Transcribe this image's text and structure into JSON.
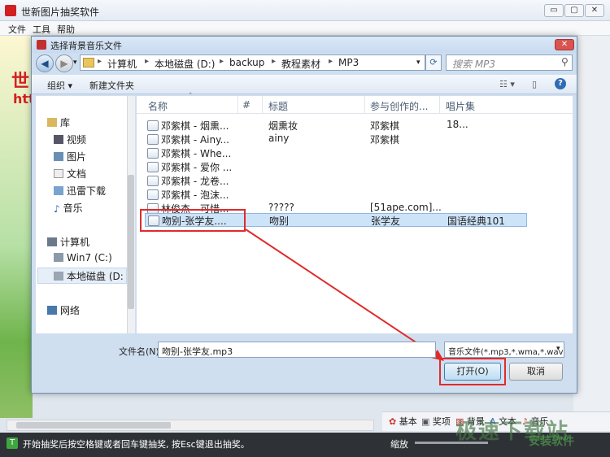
{
  "app": {
    "title": "世新图片抽奖软件",
    "menu": [
      "文件",
      "工具",
      "帮助"
    ],
    "left_text1": "世",
    "left_text2": "htt",
    "status_text": "开始抽奖后按空格键或者回车键抽奖, 按Esc键退出抽奖。",
    "status_icon": "T",
    "zoom_label": "缩放",
    "bottom_tabs": [
      "基本",
      "奖项",
      "背景",
      "文本",
      "音乐"
    ],
    "window_buttons": [
      "▭",
      "▢",
      "✕"
    ],
    "watermark": "极速下载站",
    "watermark_small": "安装软件"
  },
  "dialog": {
    "title": "选择背景音乐文件",
    "close_label": "✕",
    "breadcrumb": [
      "计算机",
      "本地磁盘 (D:)",
      "backup",
      "教程素材",
      "MP3"
    ],
    "search_placeholder": "搜索 MP3",
    "toolbar": {
      "organize": "组织 ▾",
      "new_folder": "新建文件夹"
    },
    "nav": {
      "favorites": "库",
      "libs": [
        "视频",
        "图片",
        "文档",
        "迅雷下载",
        "音乐"
      ],
      "computer": "计算机",
      "drives": [
        "Win7 (C:)",
        "本地磁盘 (D:"
      ],
      "network": "网络"
    },
    "columns": [
      "名称",
      "#",
      "标题",
      "参与创作的...",
      "唱片集"
    ],
    "files": [
      {
        "name": "邓紫棋 - 烟熏...",
        "title": "烟熏妆",
        "artist": "邓紫棋",
        "album": "18..."
      },
      {
        "name": "邓紫棋 - Ainy...",
        "title": "ainy",
        "artist": "邓紫棋",
        "album": ""
      },
      {
        "name": "邓紫棋 - Whe...",
        "title": "",
        "artist": "",
        "album": ""
      },
      {
        "name": "邓紫棋 - 爱你 ...",
        "title": "",
        "artist": "",
        "album": ""
      },
      {
        "name": "邓紫棋 - 龙卷...",
        "title": "",
        "artist": "",
        "album": ""
      },
      {
        "name": "邓紫棋 - 泡沫...",
        "title": "",
        "artist": "",
        "album": ""
      },
      {
        "name": "林俊杰 - 可惜...",
        "title": "?????",
        "artist": "[51ape.com]...",
        "album": ""
      },
      {
        "name": "吻别-张学友....",
        "title": "吻别",
        "artist": "张学友",
        "album": "国语经典101"
      }
    ],
    "filename_label": "文件名(N):",
    "filename_value": "吻别-张学友.mp3",
    "filetype_value": "音乐文件(*.mp3,*.wma,*.wav,*",
    "open_label": "打开(O)",
    "cancel_label": "取消"
  },
  "colors": {
    "accent": "#e02b2b",
    "selection": "#cde3f8",
    "status_bg": "#2e3236"
  }
}
